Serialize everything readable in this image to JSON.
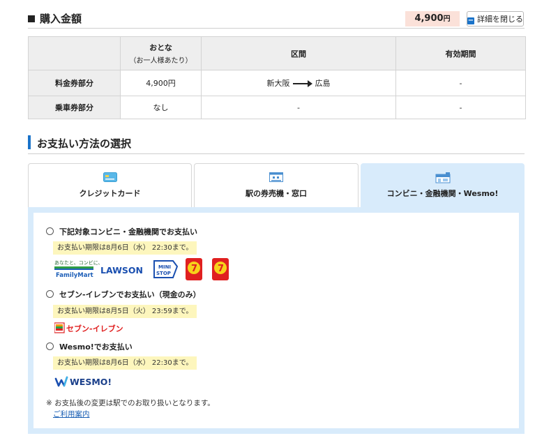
{
  "header": {
    "title": "購入金額",
    "amount": "4,900",
    "amount_unit": "円",
    "detail_button": "詳細を閉じる"
  },
  "fare_table": {
    "headers": {
      "adult": "おとな",
      "adult_sub": "（お一人様あたり）",
      "section": "区間",
      "validity": "有効期間"
    },
    "rows": [
      {
        "label": "料金券部分",
        "adult": "4,900円",
        "from": "新大阪",
        "to": "広島",
        "validity": "-"
      },
      {
        "label": "乗車券部分",
        "adult": "なし",
        "section": "-",
        "validity": "-"
      }
    ]
  },
  "payment": {
    "title": "お支払い方法の選択",
    "tabs": [
      {
        "label": "クレジットカード",
        "icon": "credit-card-icon"
      },
      {
        "label": "駅の券売機・窓口",
        "icon": "ticket-machine-icon"
      },
      {
        "label": "コンビニ・金融機関・Wesmo!",
        "icon": "convenience-store-icon",
        "active": true
      }
    ],
    "options": [
      {
        "label": "下記対象コンビニ・金融機関でお支払い",
        "deadline": "お支払い期限は8月6日（水） 22:30まで。"
      },
      {
        "label": "セブン-イレブンでお支払い（現金のみ）",
        "deadline": "お支払い期限は8月5日（火） 23:59まで。"
      },
      {
        "label": "Wesmo!でお支払い",
        "deadline": "お支払い期限は8月6日（水） 22:30まで。"
      }
    ],
    "logos": {
      "familymart_top": "あなたと、コンビに、",
      "familymart": "FamilyMart",
      "lawson": "LAWSON",
      "ministop_a": "MINI",
      "ministop_b": "STOP",
      "seven_eleven": "セブン-イレブン",
      "wesmo": "WESMO!"
    },
    "note": "※ お支払後の変更は駅でのお取り扱いとなります。",
    "guide_link": "ご利用案内"
  },
  "colors": {
    "accent_blue": "#1a73c9",
    "amount_bg": "#fbe1d9",
    "active_tab_bg": "#d8ebfb",
    "deadline_bg": "#fdf6bd"
  }
}
